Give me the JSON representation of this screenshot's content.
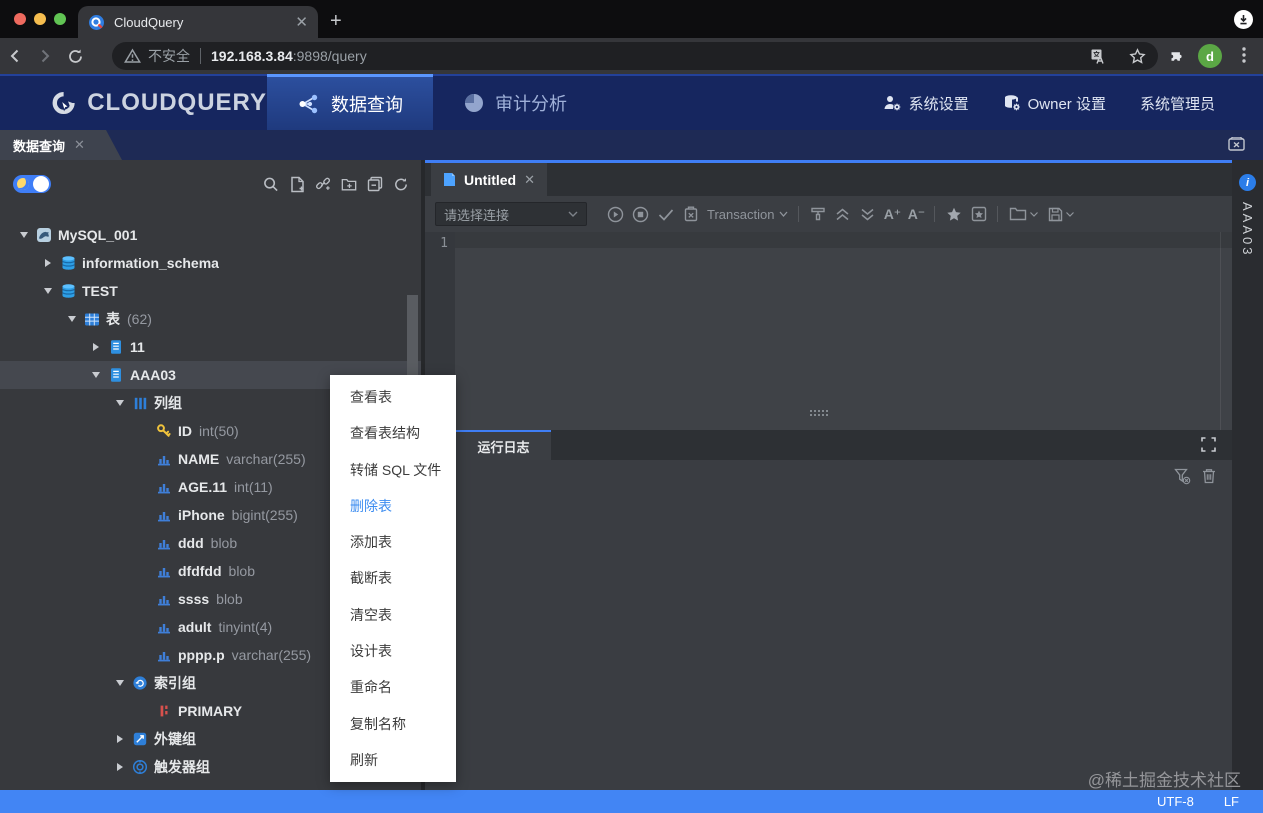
{
  "browser": {
    "tab_title": "CloudQuery",
    "security_label": "不安全",
    "url_host": "192.168.3.84",
    "url_path": ":9898/query",
    "avatar_letter": "d"
  },
  "app_header": {
    "logo": "CLOUDQUERY",
    "nav": [
      {
        "label": "数据查询",
        "active": true
      },
      {
        "label": "审计分析",
        "active": false
      }
    ],
    "settings_label": "系统设置",
    "owner_label": "Owner 设置",
    "admin_label": "系统管理员"
  },
  "workspace": {
    "tab_label": "数据查询"
  },
  "sidebar": {
    "tree": [
      {
        "label": "MySQL_001",
        "icon": "mysql",
        "caret": "down",
        "indent": 0
      },
      {
        "label": "information_schema",
        "icon": "database",
        "caret": "right",
        "indent": 1
      },
      {
        "label": "TEST",
        "icon": "database",
        "caret": "down",
        "indent": 1
      },
      {
        "label": "表",
        "suffix": "(62)",
        "icon": "table-grid",
        "caret": "down",
        "indent": 2
      },
      {
        "label": "11",
        "icon": "table",
        "caret": "right",
        "indent": 3
      },
      {
        "label": "AAA03",
        "icon": "table",
        "caret": "down",
        "indent": 3,
        "selected": true
      },
      {
        "label": "列组",
        "icon": "columns",
        "caret": "down",
        "indent": 4
      },
      {
        "label": "ID",
        "type": "int(50)",
        "icon": "key",
        "caret": "none",
        "indent": 5
      },
      {
        "label": "NAME",
        "type": "varchar(255)",
        "icon": "column",
        "caret": "none",
        "indent": 5
      },
      {
        "label": "AGE.11",
        "type": "int(11)",
        "icon": "column",
        "caret": "none",
        "indent": 5
      },
      {
        "label": "iPhone",
        "type": "bigint(255)",
        "icon": "column",
        "caret": "none",
        "indent": 5
      },
      {
        "label": "ddd",
        "type": "blob",
        "icon": "column",
        "caret": "none",
        "indent": 5
      },
      {
        "label": "dfdfdd",
        "type": "blob",
        "icon": "column",
        "caret": "none",
        "indent": 5
      },
      {
        "label": "ssss",
        "type": "blob",
        "icon": "column",
        "caret": "none",
        "indent": 5
      },
      {
        "label": "adult",
        "type": "tinyint(4)",
        "icon": "column",
        "caret": "none",
        "indent": 5
      },
      {
        "label": "pppp.p",
        "type": "varchar(255)",
        "icon": "column",
        "caret": "none",
        "indent": 5
      },
      {
        "label": "索引组",
        "icon": "index-group",
        "caret": "down",
        "indent": 4
      },
      {
        "label": "PRIMARY",
        "icon": "primary",
        "caret": "none",
        "indent": 5
      },
      {
        "label": "外键组",
        "icon": "fk-group",
        "caret": "right",
        "indent": 4
      },
      {
        "label": "触发器组",
        "icon": "trigger-group",
        "caret": "right",
        "indent": 4
      }
    ]
  },
  "editor": {
    "tab_label": "Untitled",
    "connection_placeholder": "请选择连接",
    "transaction_label": "Transaction",
    "font_plus": "A⁺",
    "font_minus": "A⁻",
    "line_number": "1"
  },
  "log_panel": {
    "tab_label": "运行日志"
  },
  "right_panel": {
    "vertical_label": "AAA03"
  },
  "context_menu": {
    "items": [
      {
        "label": "查看表"
      },
      {
        "label": "查看表结构"
      },
      {
        "label": "转储 SQL 文件"
      },
      {
        "label": "删除表",
        "highlighted": true
      },
      {
        "label": "添加表"
      },
      {
        "label": "截断表"
      },
      {
        "label": "清空表"
      },
      {
        "label": "设计表"
      },
      {
        "label": "重命名"
      },
      {
        "label": "复制名称"
      },
      {
        "label": "刷新"
      }
    ]
  },
  "status_bar": {
    "encoding": "UTF-8",
    "eol": "LF"
  },
  "watermark": "@稀土掘金技术社区",
  "colors": {
    "accent_blue": "#3f7ef5",
    "status_bar_blue": "#4285f4",
    "menu_highlight": "#3c8cf0",
    "tree_icon_blue": "#2e7fd8",
    "key_yellow": "#f0c33c",
    "primary_red": "#d8514d",
    "header_navy": "#16265f"
  }
}
